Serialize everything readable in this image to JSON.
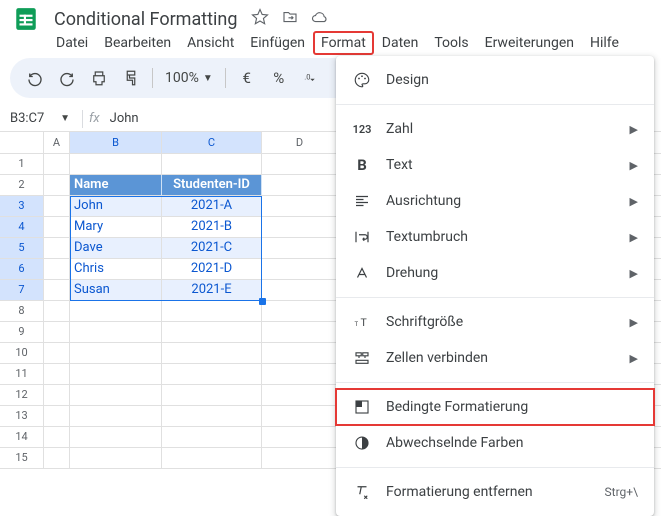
{
  "doc": {
    "title": "Conditional Formatting"
  },
  "menus": {
    "file": "Datei",
    "edit": "Bearbeiten",
    "view": "Ansicht",
    "insert": "Einfügen",
    "format": "Format",
    "data": "Daten",
    "tools": "Tools",
    "extensions": "Erweiterungen",
    "help": "Hilfe"
  },
  "toolbar": {
    "zoom": "100%",
    "currency": "€",
    "percent": "%"
  },
  "namebox": {
    "range": "B3:C7",
    "fx": "fx",
    "formula": "John"
  },
  "columns": [
    "A",
    "B",
    "C",
    "D"
  ],
  "row_headers_empty": [
    "1",
    "8",
    "9",
    "10",
    "11",
    "12",
    "13",
    "14",
    "15"
  ],
  "table": {
    "header_row": "2",
    "headers": {
      "b": "Name",
      "c": "Studenten-ID"
    },
    "rows": [
      {
        "rh": "3",
        "b": "John",
        "c": "2021-A"
      },
      {
        "rh": "4",
        "b": "Mary",
        "c": "2021-B"
      },
      {
        "rh": "5",
        "b": "Dave",
        "c": "2021-C"
      },
      {
        "rh": "6",
        "b": "Chris",
        "c": "2021-D"
      },
      {
        "rh": "7",
        "b": "Susan",
        "c": "2021-E"
      }
    ]
  },
  "format_menu": {
    "design": "Design",
    "number": "Zahl",
    "text": "Text",
    "alignment": "Ausrichtung",
    "wrapping": "Textumbruch",
    "rotation": "Drehung",
    "font_size": "Schriftgröße",
    "merge": "Zellen verbinden",
    "conditional": "Bedingte Formatierung",
    "alternating": "Abwechselnde Farben",
    "clear": "Formatierung entfernen",
    "clear_shortcut": "Strg+\\",
    "number_prefix": "123"
  }
}
